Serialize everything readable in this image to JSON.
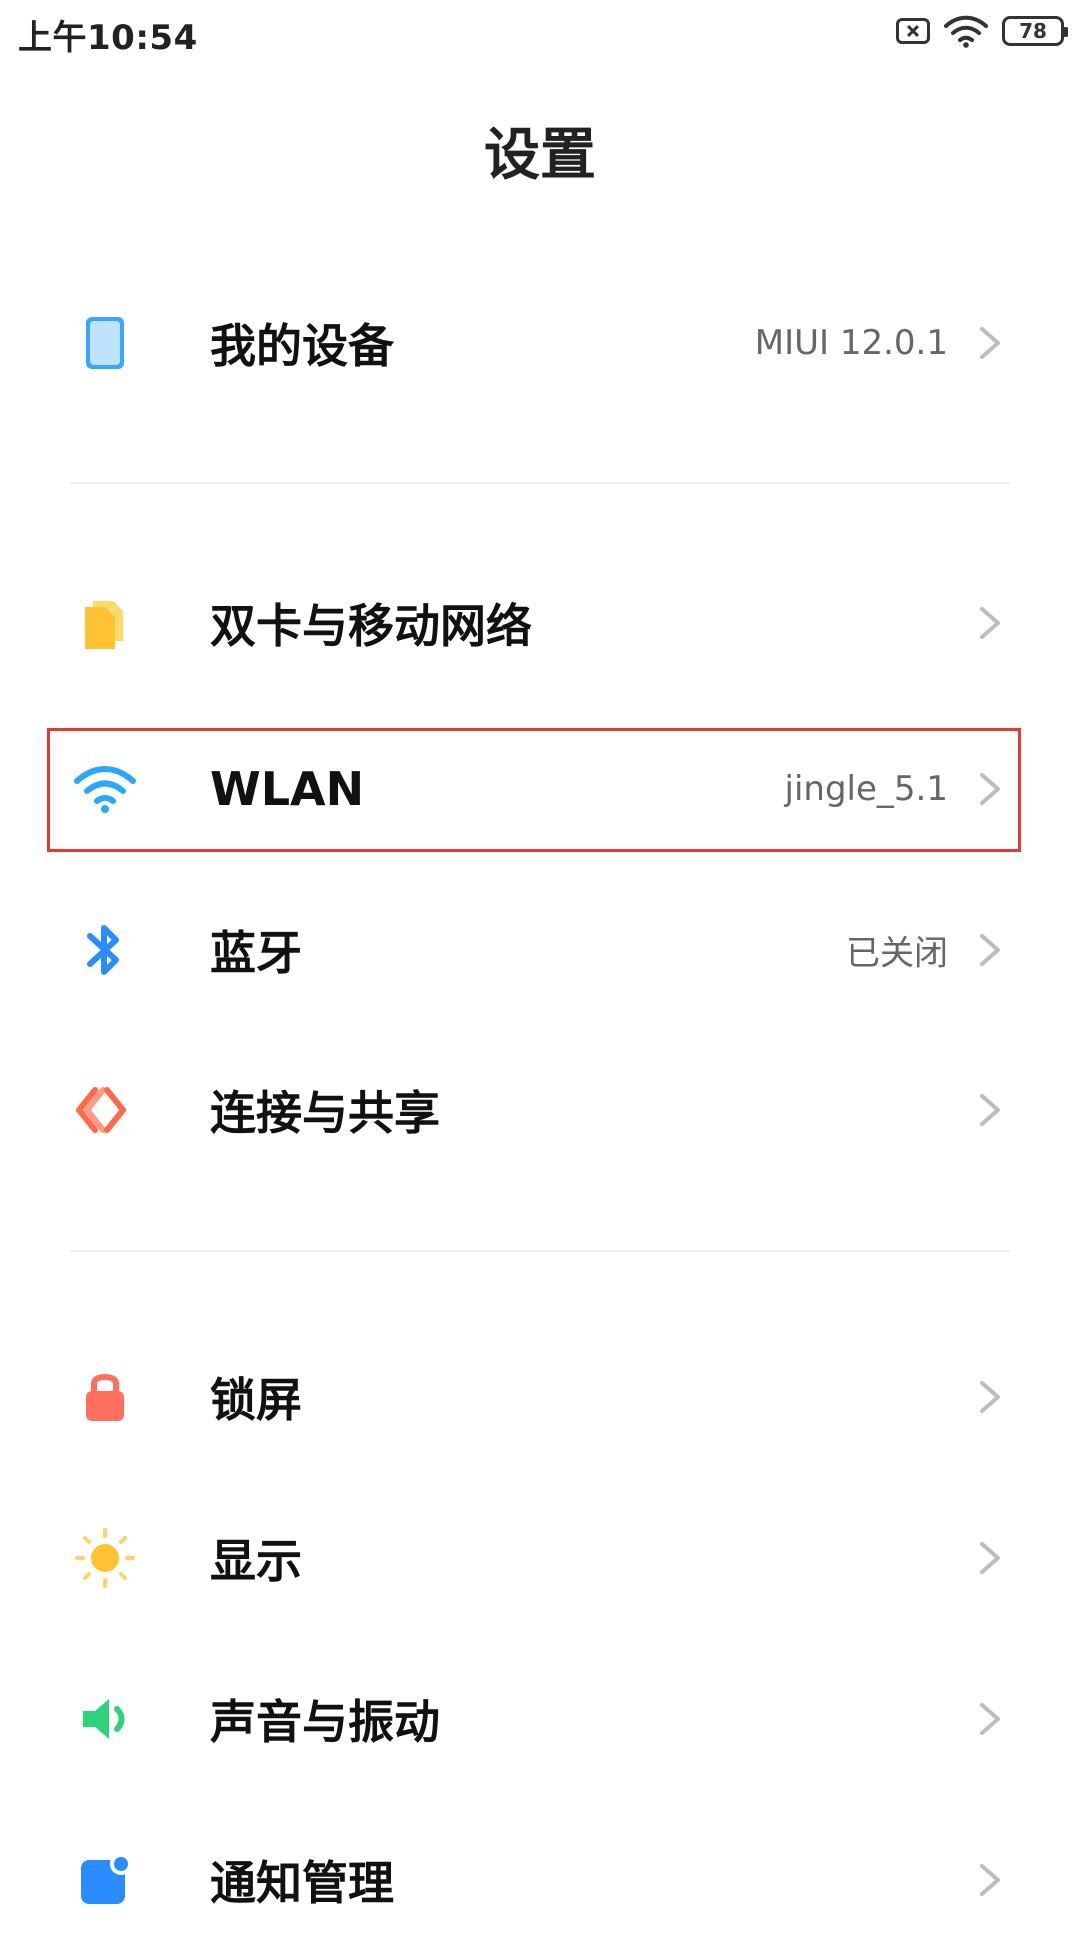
{
  "status_bar": {
    "time": "上午10:54",
    "battery": "78",
    "icons": [
      "sim-off-icon",
      "wifi-icon",
      "battery-icon"
    ]
  },
  "header": {
    "title": "设置"
  },
  "items": [
    {
      "label": "我的设备",
      "value": "MIUI 12.0.1",
      "icon": "device-icon",
      "icon_color": "#39a7ff"
    },
    {
      "label": "双卡与移动网络",
      "value": "",
      "icon": "sim-cards-icon",
      "icon_color": "#ffc233"
    },
    {
      "label": "WLAN",
      "value": "jingle_5.1",
      "icon": "wifi-icon",
      "icon_color": "#2aa7ff"
    },
    {
      "label": "蓝牙",
      "value": "已关闭",
      "icon": "bluetooth-icon",
      "icon_color": "#2a8cff"
    },
    {
      "label": "连接与共享",
      "value": "",
      "icon": "share-icon",
      "icon_color": "#ff6b4a"
    },
    {
      "label": "锁屏",
      "value": "",
      "icon": "lock-icon",
      "icon_color": "#ff6f5e"
    },
    {
      "label": "显示",
      "value": "",
      "icon": "sun-icon",
      "icon_color": "#ffc233"
    },
    {
      "label": "声音与振动",
      "value": "",
      "icon": "speaker-icon",
      "icon_color": "#2fd17b"
    },
    {
      "label": "通知管理",
      "value": "",
      "icon": "notification-icon",
      "icon_color": "#2a8cff"
    }
  ],
  "colors": {
    "highlight_border": "#e53935",
    "divider": "#eeeeee",
    "value_text": "#666666",
    "chevron": "#bdbdbd"
  }
}
